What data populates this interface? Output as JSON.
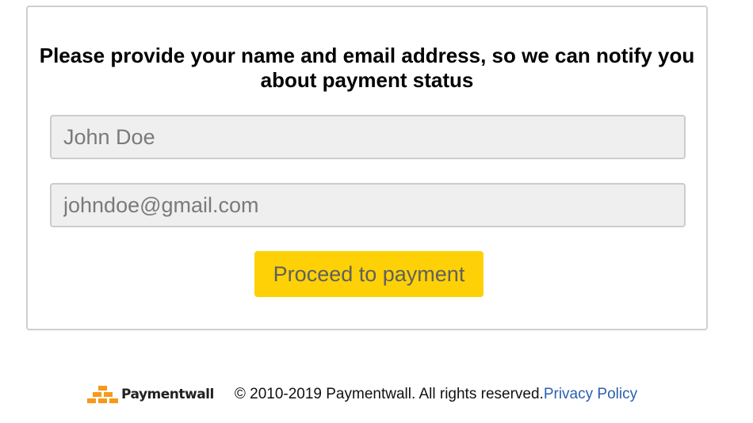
{
  "form": {
    "title": "Please provide your name and email address, so we can notify you about payment status",
    "name_placeholder": "John Doe",
    "email_placeholder": "johndoe@gmail.com",
    "submit_label": "Proceed to payment"
  },
  "footer": {
    "brand_name": "Paymentwall",
    "logo_icon": "paymentwall-bricks-icon",
    "copyright": "© 2010-2019 Paymentwall. All rights reserved.",
    "privacy_link": "Privacy Policy"
  },
  "colors": {
    "button": "#fdd106",
    "logo_orange": "#f59a1b",
    "link": "#2a5fae"
  }
}
